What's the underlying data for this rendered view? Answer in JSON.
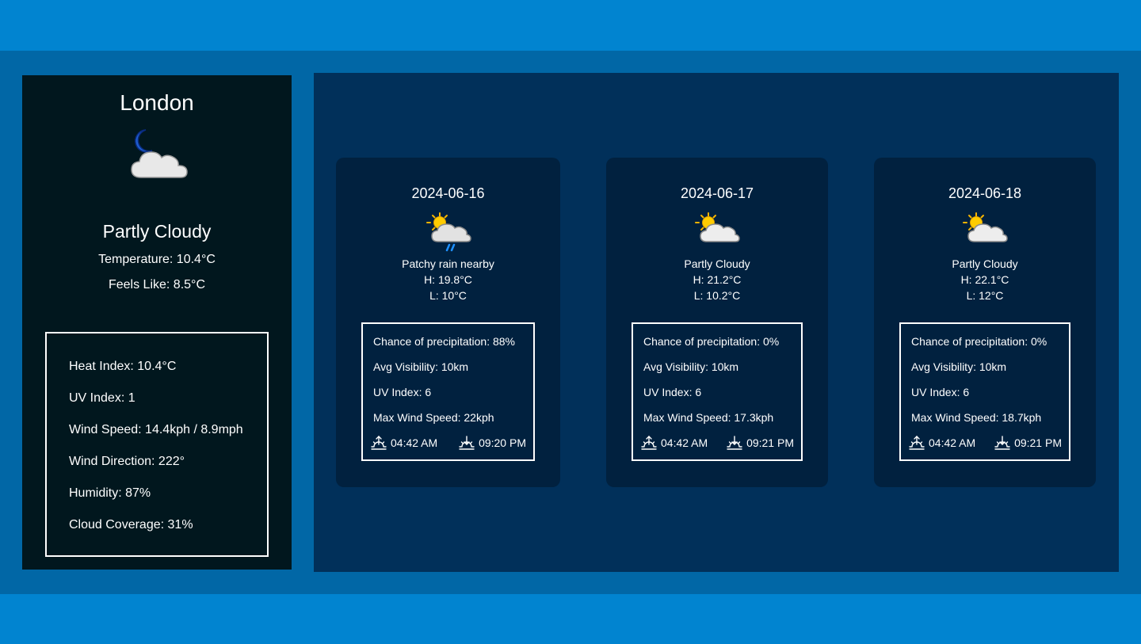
{
  "current": {
    "city": "London",
    "icon": "moon-cloud-icon",
    "condition": "Partly Cloudy",
    "temperature": "Temperature: 10.4°C",
    "feels_like": "Feels Like: 8.5°C",
    "details": {
      "heat_index": "Heat Index: 10.4°C",
      "uv_index": "UV Index: 1",
      "wind_speed": "Wind Speed: 14.4kph / 8.9mph",
      "wind_direction": "Wind Direction: 222°",
      "humidity": "Humidity: 87%",
      "cloud_coverage": "Cloud Coverage: 31%"
    }
  },
  "forecast": [
    {
      "date": "2024-06-16",
      "icon": "sun-cloud-rain-icon",
      "condition": "Patchy rain nearby",
      "high": "H: 19.8°C",
      "low": "L: 10°C",
      "precip": "Chance of precipitation: 88%",
      "visibility": "Avg Visibility: 10km",
      "uv": "UV Index: 6",
      "wind": "Max Wind Speed: 22kph",
      "sunrise": "04:42 AM",
      "sunset": "09:20 PM"
    },
    {
      "date": "2024-06-17",
      "icon": "sun-cloud-icon",
      "condition": "Partly Cloudy",
      "high": "H: 21.2°C",
      "low": "L: 10.2°C",
      "precip": "Chance of precipitation: 0%",
      "visibility": "Avg Visibility: 10km",
      "uv": "UV Index: 6",
      "wind": "Max Wind Speed: 17.3kph",
      "sunrise": "04:42 AM",
      "sunset": "09:21 PM"
    },
    {
      "date": "2024-06-18",
      "icon": "sun-cloud-icon",
      "condition": "Partly Cloudy",
      "high": "H: 22.1°C",
      "low": "L: 12°C",
      "precip": "Chance of precipitation: 0%",
      "visibility": "Avg Visibility: 10km",
      "uv": "UV Index: 6",
      "wind": "Max Wind Speed: 18.7kph",
      "sunrise": "04:42 AM",
      "sunset": "09:21 PM"
    }
  ],
  "colors": {
    "page_bg": "#0184d0",
    "band_bg": "#0167a6",
    "current_bg": "#01171e",
    "forecast_bg": "#01305a",
    "card_bg": "#01213f",
    "text": "#ffffff"
  }
}
